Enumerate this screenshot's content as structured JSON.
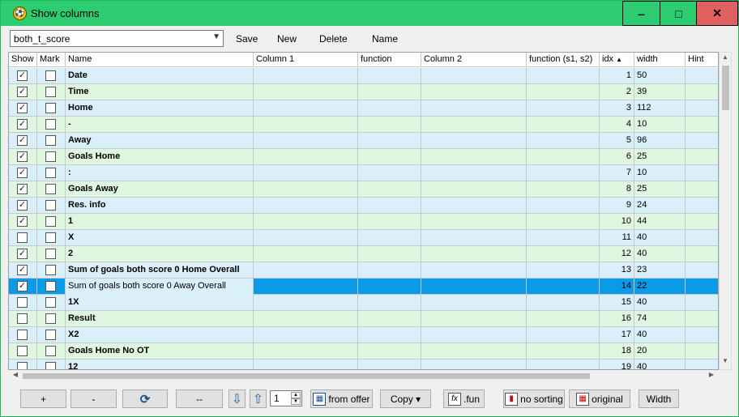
{
  "window": {
    "title": "Show columns",
    "minimize": "‒",
    "maximize": "□",
    "close": "✕"
  },
  "toolbar": {
    "preset_value": "both_t_score",
    "save": "Save",
    "new": "New",
    "delete": "Delete",
    "name": "Name"
  },
  "grid": {
    "headers": {
      "show": "Show",
      "mark": "Mark",
      "name": "Name",
      "col1": "Column 1",
      "function": "function",
      "col2": "Column 2",
      "function_s": "function (s1, s2)",
      "idx": "idx",
      "width": "width",
      "hint": "Hint"
    },
    "rows": [
      {
        "show": true,
        "mark": false,
        "name": "Date",
        "idx": "1",
        "width": "50",
        "bold": true
      },
      {
        "show": true,
        "mark": false,
        "name": "Time",
        "idx": "2",
        "width": "39",
        "bold": true
      },
      {
        "show": true,
        "mark": false,
        "name": "Home",
        "idx": "3",
        "width": "112",
        "bold": true
      },
      {
        "show": true,
        "mark": false,
        "name": "-",
        "idx": "4",
        "width": "10",
        "bold": true
      },
      {
        "show": true,
        "mark": false,
        "name": "Away",
        "idx": "5",
        "width": "96",
        "bold": true
      },
      {
        "show": true,
        "mark": false,
        "name": "Goals Home",
        "idx": "6",
        "width": "25",
        "bold": true
      },
      {
        "show": true,
        "mark": false,
        "name": ":",
        "idx": "7",
        "width": "10",
        "bold": true
      },
      {
        "show": true,
        "mark": false,
        "name": "Goals Away",
        "idx": "8",
        "width": "25",
        "bold": true
      },
      {
        "show": true,
        "mark": false,
        "name": "Res. info",
        "idx": "9",
        "width": "24",
        "bold": true
      },
      {
        "show": true,
        "mark": false,
        "name": "1",
        "idx": "10",
        "width": "44",
        "bold": true
      },
      {
        "show": false,
        "mark": false,
        "name": "X",
        "idx": "11",
        "width": "40",
        "bold": true
      },
      {
        "show": true,
        "mark": false,
        "name": "2",
        "idx": "12",
        "width": "40",
        "bold": true
      },
      {
        "show": true,
        "mark": false,
        "name": "Sum of goals both score 0 Home Overall",
        "idx": "13",
        "width": "23",
        "bold": true
      },
      {
        "show": true,
        "mark": false,
        "name": "Sum of goals both score 0 Away Overall",
        "idx": "14",
        "width": "22",
        "bold": false,
        "selected": true
      },
      {
        "show": false,
        "mark": false,
        "name": "1X",
        "idx": "15",
        "width": "40",
        "bold": true
      },
      {
        "show": false,
        "mark": false,
        "name": "Result",
        "idx": "16",
        "width": "74",
        "bold": true
      },
      {
        "show": false,
        "mark": false,
        "name": "X2",
        "idx": "17",
        "width": "40",
        "bold": true
      },
      {
        "show": false,
        "mark": false,
        "name": "Goals Home No OT",
        "idx": "18",
        "width": "20",
        "bold": true
      },
      {
        "show": false,
        "mark": false,
        "name": "12",
        "idx": "19",
        "width": "40",
        "bold": true
      }
    ]
  },
  "bottom": {
    "add": "+",
    "remove": "-",
    "refresh": "⟳",
    "dashes": "--",
    "down": "⇩",
    "up": "⇧",
    "spin_value": "1",
    "from_offer": "from offer",
    "copy": "Copy ▾",
    "fun": ".fun",
    "no_sorting": "no sorting",
    "original": "original",
    "width": "Width"
  },
  "colors": {
    "titlebar": "#2ecc71",
    "row_blue": "#d9f0fb",
    "row_green": "#dff7e0",
    "selected": "#0a9ae8",
    "close": "#e06060"
  }
}
